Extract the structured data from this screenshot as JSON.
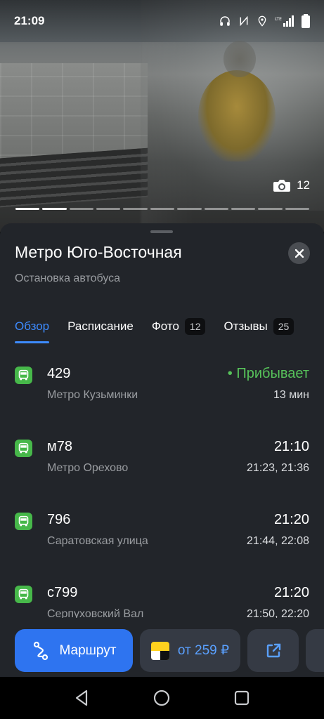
{
  "status_bar": {
    "time": "21:09",
    "icons": [
      "headphones-icon",
      "nfc-icon",
      "location-icon",
      "lte-signal-icon",
      "battery-icon"
    ]
  },
  "photo": {
    "count": "12",
    "pages": 11,
    "active_page": 1
  },
  "stop": {
    "title": "Метро Юго-Восточная",
    "subtitle": "Остановка автобуса"
  },
  "tabs": [
    {
      "label": "Обзор",
      "badge": ""
    },
    {
      "label": "Расписание",
      "badge": ""
    },
    {
      "label": "Фото",
      "badge": "12"
    },
    {
      "label": "Отзывы",
      "badge": "25"
    }
  ],
  "routes": [
    {
      "number": "429",
      "destination": "Метро Кузьминки",
      "time": "• Прибывает",
      "next": "13 мин",
      "arriving": true
    },
    {
      "number": "м78",
      "destination": "Метро Орехово",
      "time": "21:10",
      "next": "21:23, 21:36",
      "arriving": false
    },
    {
      "number": "796",
      "destination": "Саратовская улица",
      "time": "21:20",
      "next": "21:44, 22:08",
      "arriving": false
    },
    {
      "number": "с799",
      "destination": "Серпуховский Вал",
      "time": "21:20",
      "next": "21:50, 22:20",
      "arriving": false
    }
  ],
  "actions": {
    "route_label": "Маршрут",
    "taxi_label": "от 259 ₽"
  },
  "colors": {
    "accent": "#3d8bff",
    "bus_green": "#47b84a",
    "arriving": "#57c25a",
    "sheet_bg": "#22252a"
  }
}
